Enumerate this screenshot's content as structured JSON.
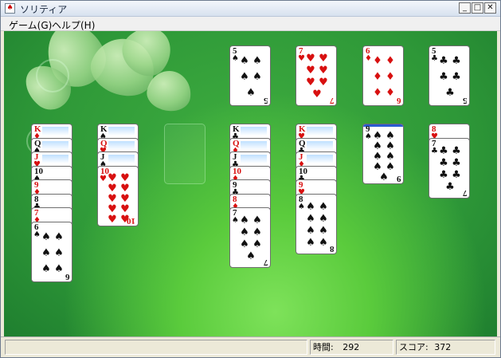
{
  "window": {
    "title": "ソリティア",
    "app_icon": "♠"
  },
  "menu": {
    "items": [
      "ゲーム(G)",
      "ヘルプ(H)"
    ]
  },
  "foundations": [
    {
      "rank": "5",
      "suit": "♠",
      "color": "black",
      "pips": [
        "♠",
        "♠",
        "♠",
        "♠",
        "♠"
      ]
    },
    {
      "rank": "7",
      "suit": "♥",
      "color": "red",
      "pips": [
        "♥",
        "♥",
        "♥",
        "♥",
        "♥",
        "♥",
        "♥"
      ]
    },
    {
      "rank": "6",
      "suit": "♦",
      "color": "red",
      "pips": [
        "♦",
        "♦",
        "♦",
        "♦",
        "♦",
        "♦"
      ]
    },
    {
      "rank": "5",
      "suit": "♣",
      "color": "black",
      "pips": [
        "♣",
        "♣",
        "♣",
        "♣",
        "♣"
      ]
    }
  ],
  "tableau": [
    {
      "cards": [
        {
          "rank": "K",
          "suit": "♦",
          "color": "red"
        },
        {
          "rank": "Q",
          "suit": "♠",
          "color": "black"
        },
        {
          "rank": "J",
          "suit": "♥",
          "color": "red"
        },
        {
          "rank": "10",
          "suit": "♠",
          "color": "black"
        },
        {
          "rank": "9",
          "suit": "♦",
          "color": "red"
        },
        {
          "rank": "8",
          "suit": "♣",
          "color": "black"
        },
        {
          "rank": "7",
          "suit": "♦",
          "color": "red"
        },
        {
          "rank": "6",
          "suit": "♠",
          "color": "black",
          "pips": [
            "♠",
            "♠",
            "♠",
            "♠",
            "♠",
            "♠"
          ]
        }
      ]
    },
    {
      "cards": [
        {
          "rank": "K",
          "suit": "♠",
          "color": "black"
        },
        {
          "rank": "Q",
          "suit": "♥",
          "color": "red"
        },
        {
          "rank": "J",
          "suit": "♠",
          "color": "black"
        },
        {
          "rank": "10",
          "suit": "♥",
          "color": "red",
          "pips": [
            "♥",
            "♥",
            "♥",
            "♥",
            "♥",
            "♥",
            "♥",
            "♥",
            "♥",
            "♥"
          ]
        }
      ]
    },
    {
      "cards": []
    },
    {
      "cards": [
        {
          "rank": "K",
          "suit": "♣",
          "color": "black"
        },
        {
          "rank": "Q",
          "suit": "♦",
          "color": "red"
        },
        {
          "rank": "J",
          "suit": "♣",
          "color": "black"
        },
        {
          "rank": "10",
          "suit": "♦",
          "color": "red"
        },
        {
          "rank": "9",
          "suit": "♣",
          "color": "black"
        },
        {
          "rank": "8",
          "suit": "♦",
          "color": "red"
        },
        {
          "rank": "7",
          "suit": "♠",
          "color": "black",
          "pips": [
            "♠",
            "♠",
            "♠",
            "♠",
            "♠",
            "♠",
            "♠"
          ]
        }
      ]
    },
    {
      "cards": [
        {
          "rank": "K",
          "suit": "♥",
          "color": "red"
        },
        {
          "rank": "Q",
          "suit": "♣",
          "color": "black"
        },
        {
          "rank": "J",
          "suit": "♦",
          "color": "red"
        },
        {
          "rank": "10",
          "suit": "♣",
          "color": "black"
        },
        {
          "rank": "9",
          "suit": "♥",
          "color": "red"
        },
        {
          "rank": "8",
          "suit": "♠",
          "color": "black",
          "pips": [
            "♠",
            "♠",
            "♠",
            "♠",
            "♠",
            "♠",
            "♠",
            "♠"
          ]
        }
      ]
    },
    {
      "cards": [
        {
          "rank": "9",
          "suit": "♠",
          "color": "black",
          "pips": [
            "♠",
            "♠",
            "♠",
            "♠",
            "♠",
            "♠",
            "♠",
            "♠",
            "♠"
          ],
          "back_strip": true
        }
      ]
    },
    {
      "cards": [
        {
          "rank": "8",
          "suit": "♥",
          "color": "red"
        },
        {
          "rank": "7",
          "suit": "♣",
          "color": "black",
          "pips": [
            "♣",
            "♣",
            "♣",
            "♣",
            "♣",
            "♣",
            "♣"
          ]
        }
      ]
    }
  ],
  "status": {
    "time_label": "時間:",
    "time_value": "292",
    "score_label": "スコア:",
    "score_value": "372"
  },
  "colors": {
    "red_suit": "#d81010",
    "black_suit": "#111111",
    "felt": "#2e9838"
  }
}
